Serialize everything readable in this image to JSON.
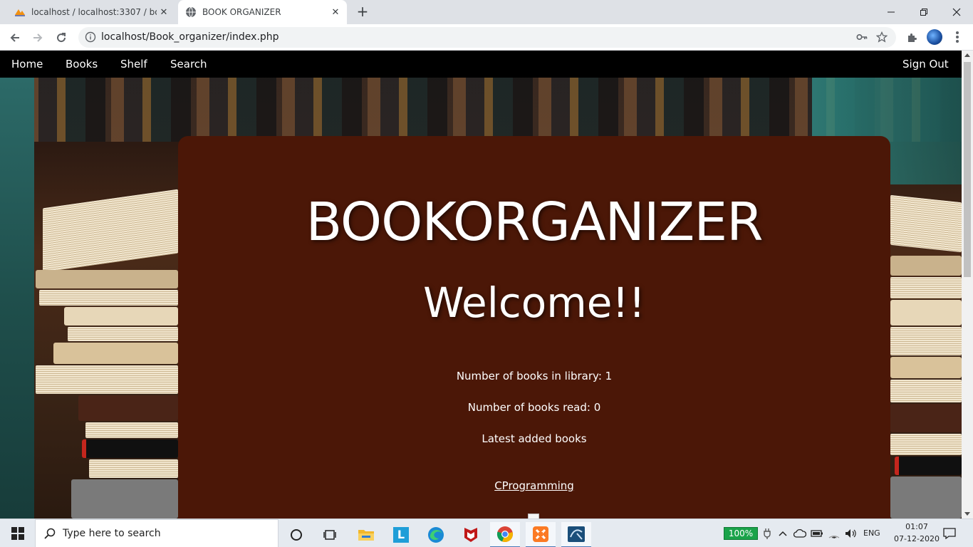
{
  "browser": {
    "tabs": [
      {
        "title": "localhost / localhost:3307 / book",
        "active": false
      },
      {
        "title": "BOOK ORGANIZER",
        "active": true
      }
    ],
    "new_tab_label": "+",
    "address": "localhost/Book_organizer/index.php"
  },
  "site_nav": {
    "items": [
      "Home",
      "Books",
      "Shelf",
      "Search"
    ],
    "sign_out": "Sign Out"
  },
  "card": {
    "title": "BOOKORGANIZER",
    "welcome": "Welcome!!",
    "books_in_library": "Number of books in library: 1",
    "books_read": "Number of books read: 0",
    "latest_heading": "Latest added books",
    "latest_book": "CProgramming"
  },
  "taskbar": {
    "search_placeholder": "Type here to search",
    "battery": "100%",
    "language": "ENG",
    "time": "01:07",
    "date": "07-12-2020"
  },
  "colors": {
    "card_bg": "#4b1707",
    "nav_bg": "#000000",
    "text": "#ffffff"
  }
}
